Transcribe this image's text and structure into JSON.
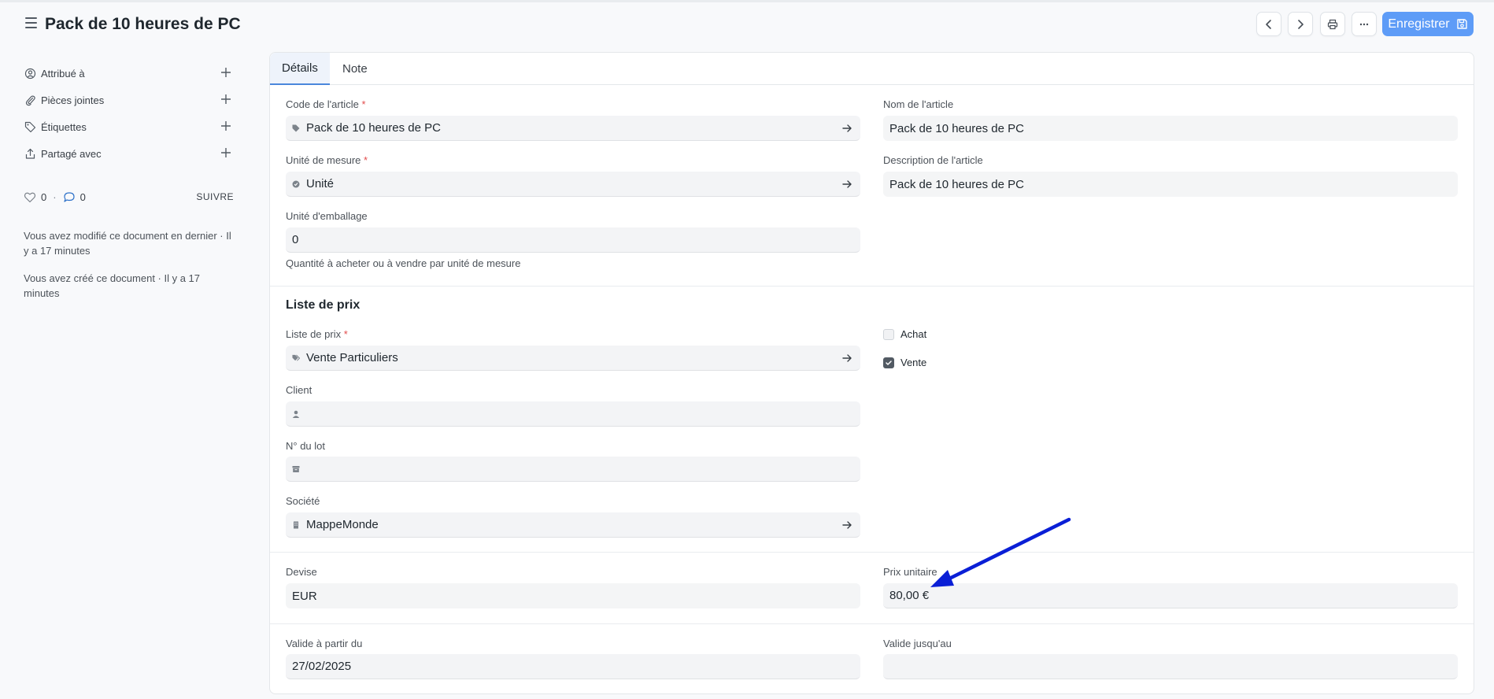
{
  "header": {
    "title": "Pack de 10 heures de PC",
    "save_label": "Enregistrer"
  },
  "sidebar": {
    "items": [
      {
        "label": "Attribué à",
        "icon": "user-plus-icon"
      },
      {
        "label": "Pièces jointes",
        "icon": "paperclip-icon"
      },
      {
        "label": "Étiquettes",
        "icon": "tag-icon"
      },
      {
        "label": "Partagé avec",
        "icon": "share-icon"
      }
    ],
    "likes_count": "0",
    "comments_count": "0",
    "follow_label": "SUIVRE",
    "activity": [
      "Vous avez modifié ce document en dernier · Il y a 17 minutes",
      "Vous avez créé ce document · Il y a 17 minutes"
    ]
  },
  "tabs": [
    {
      "label": "Détails",
      "active": true
    },
    {
      "label": "Note",
      "active": false
    }
  ],
  "form": {
    "item_code": {
      "label": "Code de l'article",
      "value": "Pack de 10 heures de PC"
    },
    "item_name": {
      "label": "Nom de l'article",
      "value": "Pack de 10 heures de PC"
    },
    "uom": {
      "label": "Unité de mesure",
      "value": "Unité"
    },
    "item_description": {
      "label": "Description de l'article",
      "value": "Pack de 10 heures de PC"
    },
    "packing_unit": {
      "label": "Unité d'emballage",
      "value": "0",
      "help": "Quantité à acheter ou à vendre par unité de mesure"
    },
    "price_list_section": "Liste de prix",
    "price_list": {
      "label": "Liste de prix",
      "value": "Vente Particuliers"
    },
    "buying": {
      "label": "Achat",
      "checked": false
    },
    "selling": {
      "label": "Vente",
      "checked": true
    },
    "customer": {
      "label": "Client",
      "value": ""
    },
    "batch_no": {
      "label": "N° du lot",
      "value": ""
    },
    "company": {
      "label": "Société",
      "value": "MappeMonde"
    },
    "currency": {
      "label": "Devise",
      "value": "EUR"
    },
    "rate": {
      "label": "Prix unitaire",
      "value": "80,00 €"
    },
    "valid_from": {
      "label": "Valide à partir du",
      "value": "27/02/2025"
    },
    "valid_upto": {
      "label": "Valide jusqu'au",
      "value": ""
    }
  },
  "colors": {
    "primary": "#5e9cf7",
    "annotation_arrow": "#0a1fd6",
    "required": "#e24c4c"
  }
}
